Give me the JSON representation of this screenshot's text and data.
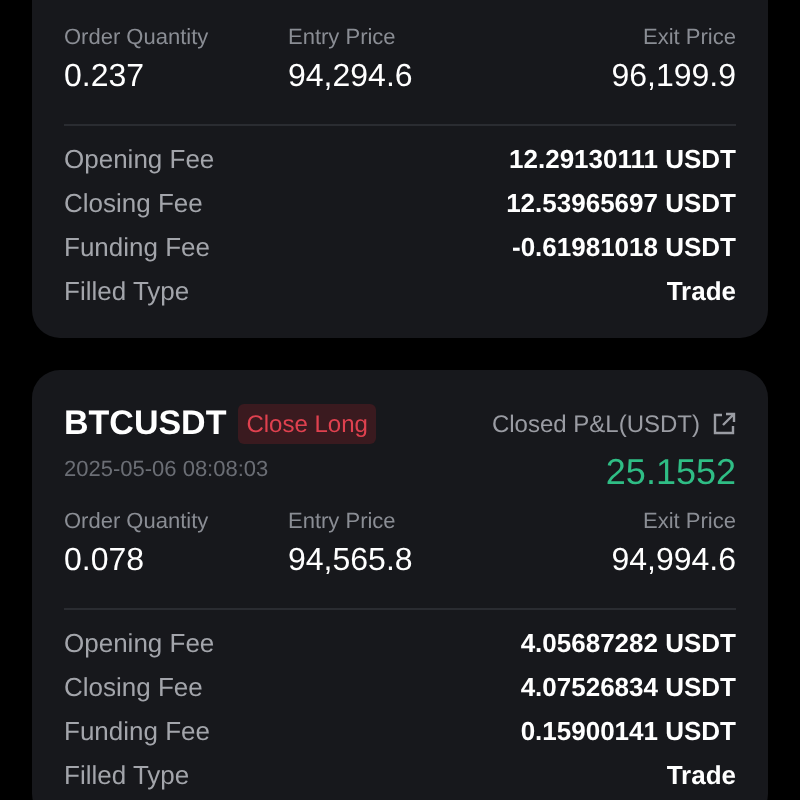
{
  "trades": [
    {
      "summary": [
        {
          "label": "Order Quantity",
          "value": "0.237"
        },
        {
          "label": "Entry Price",
          "value": "94,294.6"
        },
        {
          "label": "Exit Price",
          "value": "96,199.9"
        }
      ],
      "fees": [
        {
          "label": "Opening Fee",
          "value": "12.29130111 USDT"
        },
        {
          "label": "Closing Fee",
          "value": "12.53965697 USDT"
        },
        {
          "label": "Funding Fee",
          "value": "-0.61981018 USDT"
        },
        {
          "label": "Filled Type",
          "value": "Trade"
        }
      ]
    },
    {
      "symbol": "BTCUSDT",
      "side": "Close Long",
      "time": "2025-05-06 08:08:03",
      "pnl_label": "Closed P&L(USDT)",
      "pnl": "25.1552",
      "summary": [
        {
          "label": "Order Quantity",
          "value": "0.078"
        },
        {
          "label": "Entry Price",
          "value": "94,565.8"
        },
        {
          "label": "Exit Price",
          "value": "94,994.6"
        }
      ],
      "fees": [
        {
          "label": "Opening Fee",
          "value": "4.05687282 USDT"
        },
        {
          "label": "Closing Fee",
          "value": "4.07526834 USDT"
        },
        {
          "label": "Funding Fee",
          "value": "0.15900141 USDT"
        },
        {
          "label": "Filled Type",
          "value": "Trade"
        }
      ]
    }
  ]
}
